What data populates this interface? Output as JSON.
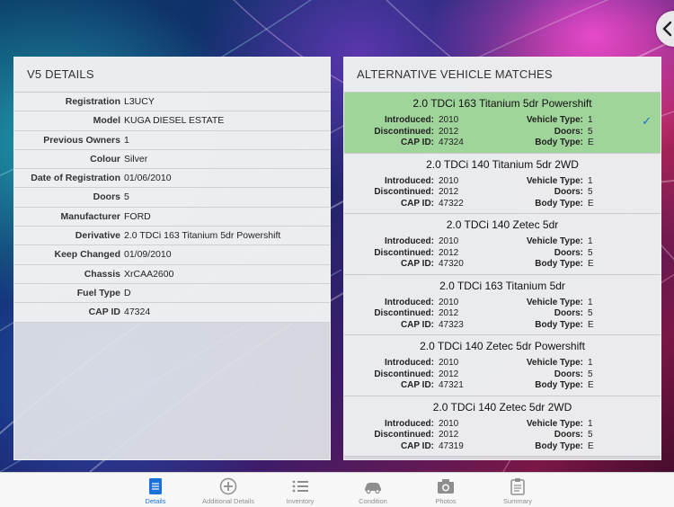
{
  "colors": {
    "selected_row": "#9fd49a",
    "accent": "#1a72d8",
    "tab_inactive": "#8e8e8e"
  },
  "back_icon": "chevron-left-icon",
  "v5": {
    "title": "V5 DETAILS",
    "rows": [
      {
        "label": "Registration",
        "value": "L3UCY"
      },
      {
        "label": "Model",
        "value": "KUGA DIESEL ESTATE"
      },
      {
        "label": "Previous Owners",
        "value": "1"
      },
      {
        "label": "Colour",
        "value": "Silver"
      },
      {
        "label": "Date of Registration",
        "value": "01/06/2010"
      },
      {
        "label": "Doors",
        "value": "5"
      },
      {
        "label": "Manufacturer",
        "value": "FORD"
      },
      {
        "label": "Derivative",
        "value": "2.0 TDCi 163 Titanium 5dr Powershift"
      },
      {
        "label": "Keep Changed",
        "value": "01/09/2010"
      },
      {
        "label": "Chassis",
        "value": "XrCAA2600"
      },
      {
        "label": "Fuel Type",
        "value": "D"
      },
      {
        "label": "CAP ID",
        "value": "47324"
      }
    ]
  },
  "matches": {
    "title": "ALTERNATIVE VEHICLE MATCHES",
    "labels": {
      "introduced": "Introduced:",
      "discontinued": "Discontinued:",
      "cap_id": "CAP ID:",
      "vehicle_type": "Vehicle Type:",
      "doors": "Doors:",
      "body_type": "Body Type:"
    },
    "check_icon": "checkmark-icon",
    "items": [
      {
        "name": "2.0 TDCi 163 Titanium 5dr Powershift",
        "introduced": "2010",
        "discontinued": "2012",
        "cap_id": "47324",
        "vehicle_type": "1",
        "doors": "5",
        "body_type": "E",
        "selected": true
      },
      {
        "name": "2.0 TDCi 140 Titanium 5dr 2WD",
        "introduced": "2010",
        "discontinued": "2012",
        "cap_id": "47322",
        "vehicle_type": "1",
        "doors": "5",
        "body_type": "E",
        "selected": false
      },
      {
        "name": "2.0 TDCi 140 Zetec 5dr",
        "introduced": "2010",
        "discontinued": "2012",
        "cap_id": "47320",
        "vehicle_type": "1",
        "doors": "5",
        "body_type": "E",
        "selected": false
      },
      {
        "name": "2.0 TDCi 163 Titanium 5dr",
        "introduced": "2010",
        "discontinued": "2012",
        "cap_id": "47323",
        "vehicle_type": "1",
        "doors": "5",
        "body_type": "E",
        "selected": false
      },
      {
        "name": "2.0 TDCi 140 Zetec 5dr Powershift",
        "introduced": "2010",
        "discontinued": "2012",
        "cap_id": "47321",
        "vehicle_type": "1",
        "doors": "5",
        "body_type": "E",
        "selected": false
      },
      {
        "name": "2.0 TDCi 140 Zetec 5dr 2WD",
        "introduced": "2010",
        "discontinued": "2012",
        "cap_id": "47319",
        "vehicle_type": "1",
        "doors": "5",
        "body_type": "E",
        "selected": false
      }
    ]
  },
  "tabs": [
    {
      "label": "Details",
      "icon": "document-icon",
      "active": true
    },
    {
      "label": "Additional Details",
      "icon": "plus-circle-icon",
      "active": false
    },
    {
      "label": "Inventory",
      "icon": "list-icon",
      "active": false
    },
    {
      "label": "Condition",
      "icon": "car-icon",
      "active": false
    },
    {
      "label": "Photos",
      "icon": "camera-icon",
      "active": false
    },
    {
      "label": "Summary",
      "icon": "clipboard-icon",
      "active": false
    }
  ]
}
